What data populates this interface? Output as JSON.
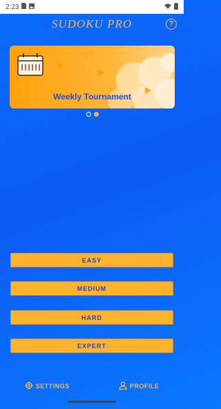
{
  "status_bar": {
    "time": "2:23",
    "icons": [
      "sim-card-icon",
      "photo-icon",
      "wifi-icon",
      "battery-icon"
    ]
  },
  "header": {
    "title": "SUDOKU PRO",
    "help_icon": "?"
  },
  "banner": {
    "title": "Weekly Tournament",
    "icon": "calendar-icon"
  },
  "carousel": {
    "pages": 2,
    "active_index": 1
  },
  "levels": {
    "easy": "EASY",
    "medium": "MEDIUM",
    "hard": "HARD",
    "expert": "EXPERT"
  },
  "bottom_nav": {
    "settings": "SETTINGS",
    "profile": "PROFILE"
  },
  "colors": {
    "accent": "#ffb347",
    "button": "#ffb22e",
    "button_text": "#1a46d9",
    "background": "#0a6cff"
  }
}
